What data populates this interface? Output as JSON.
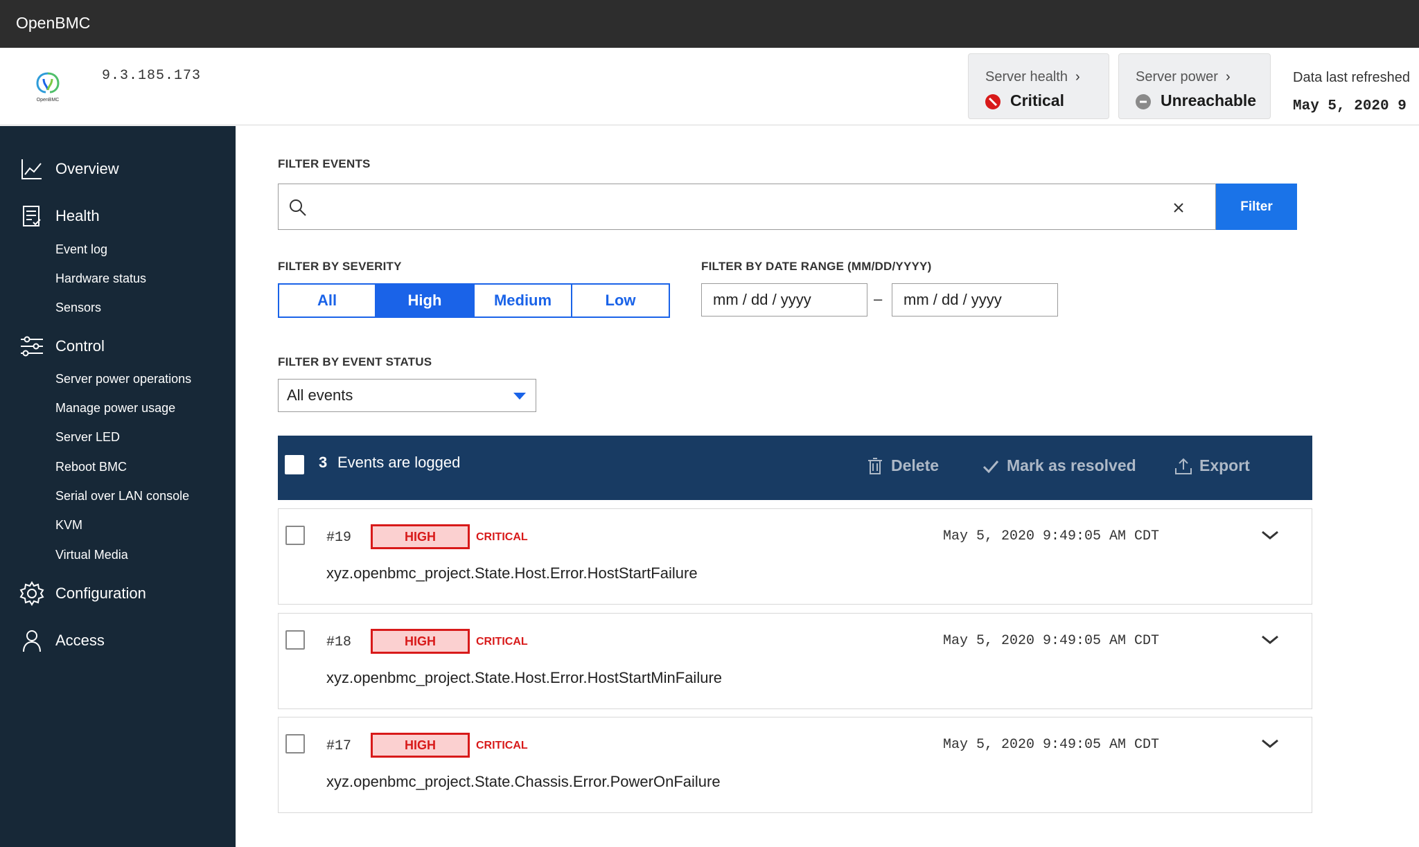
{
  "app": {
    "brand": "OpenBMC"
  },
  "header": {
    "ip": "9.3.185.173",
    "server_health": {
      "label": "Server health",
      "value": "Critical"
    },
    "server_power": {
      "label": "Server power",
      "value": "Unreachable"
    },
    "refresh": {
      "label": "Data last refreshed",
      "value": "May 5, 2020 9"
    }
  },
  "sidebar": {
    "overview": "Overview",
    "health": {
      "label": "Health",
      "items": [
        "Event log",
        "Hardware status",
        "Sensors"
      ]
    },
    "control": {
      "label": "Control",
      "items": [
        "Server power operations",
        "Manage power usage",
        "Server LED",
        "Reboot BMC",
        "Serial over LAN console",
        "KVM",
        "Virtual Media"
      ]
    },
    "configuration": "Configuration",
    "access": "Access"
  },
  "filters": {
    "events_label": "FILTER EVENTS",
    "search_placeholder": "",
    "filter_button": "Filter",
    "severity_label": "FILTER BY SEVERITY",
    "severity_options": [
      "All",
      "High",
      "Medium",
      "Low"
    ],
    "severity_selected": "High",
    "date_label": "FILTER BY DATE RANGE (MM/DD/YYYY)",
    "date_from": "mm / dd / yyyy",
    "date_separator": "–",
    "date_to": "mm / dd / yyyy",
    "status_label": "FILTER BY EVENT STATUS",
    "status_value": "All events"
  },
  "toolbar": {
    "count": "3",
    "text": "Events are logged",
    "delete": "Delete",
    "resolve": "Mark as resolved",
    "export": "Export"
  },
  "events": [
    {
      "id": "#19",
      "severity": "HIGH",
      "status": "CRITICAL",
      "date": "May 5, 2020 9:49:05 AM CDT",
      "message": "xyz.openbmc_project.State.Host.Error.HostStartFailure"
    },
    {
      "id": "#18",
      "severity": "HIGH",
      "status": "CRITICAL",
      "date": "May 5, 2020 9:49:05 AM CDT",
      "message": "xyz.openbmc_project.State.Host.Error.HostStartMinFailure"
    },
    {
      "id": "#17",
      "severity": "HIGH",
      "status": "CRITICAL",
      "date": "May 5, 2020 9:49:05 AM CDT",
      "message": "xyz.openbmc_project.State.Chassis.Error.PowerOnFailure"
    }
  ],
  "colors": {
    "sidebar_bg": "#172837",
    "accent": "#1a63e8",
    "toolbar_bg": "#183b63",
    "critical": "#d81a1a"
  }
}
